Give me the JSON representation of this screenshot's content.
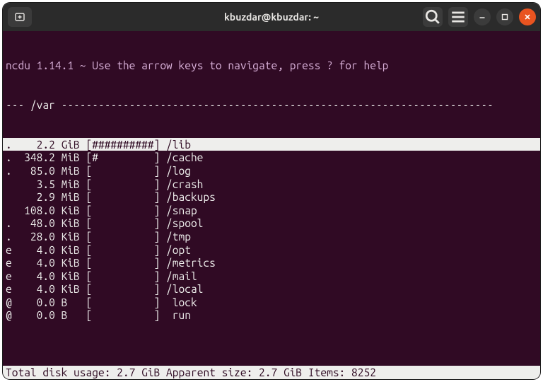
{
  "window": {
    "title": "kbuzdar@kbuzdar: ~"
  },
  "ncdu": {
    "header": "ncdu 1.14.1 ~ Use the arrow keys to navigate, press ? for help",
    "path_line": "--- /var ----------------------------------------------------------------------",
    "footer": " Total disk usage:   2.7 GiB  Apparent size:   2.7 GiB  Items: 8252",
    "rows": [
      {
        "flag": ".",
        "size": "2.2",
        "unit": "GiB",
        "bar": "[##########]",
        "name": "/lib",
        "selected": true
      },
      {
        "flag": ".",
        "size": "348.2",
        "unit": "MiB",
        "bar": "[#         ]",
        "name": "/cache",
        "selected": false
      },
      {
        "flag": ".",
        "size": "85.0",
        "unit": "MiB",
        "bar": "[          ]",
        "name": "/log",
        "selected": false
      },
      {
        "flag": " ",
        "size": "3.5",
        "unit": "MiB",
        "bar": "[          ]",
        "name": "/crash",
        "selected": false
      },
      {
        "flag": " ",
        "size": "2.9",
        "unit": "MiB",
        "bar": "[          ]",
        "name": "/backups",
        "selected": false
      },
      {
        "flag": " ",
        "size": "108.0",
        "unit": "KiB",
        "bar": "[          ]",
        "name": "/snap",
        "selected": false
      },
      {
        "flag": ".",
        "size": "48.0",
        "unit": "KiB",
        "bar": "[          ]",
        "name": "/spool",
        "selected": false
      },
      {
        "flag": ".",
        "size": "28.0",
        "unit": "KiB",
        "bar": "[          ]",
        "name": "/tmp",
        "selected": false
      },
      {
        "flag": "e",
        "size": "4.0",
        "unit": "KiB",
        "bar": "[          ]",
        "name": "/opt",
        "selected": false
      },
      {
        "flag": "e",
        "size": "4.0",
        "unit": "KiB",
        "bar": "[          ]",
        "name": "/metrics",
        "selected": false
      },
      {
        "flag": "e",
        "size": "4.0",
        "unit": "KiB",
        "bar": "[          ]",
        "name": "/mail",
        "selected": false
      },
      {
        "flag": "e",
        "size": "4.0",
        "unit": "KiB",
        "bar": "[          ]",
        "name": "/local",
        "selected": false
      },
      {
        "flag": "@",
        "size": "0.0",
        "unit": "B",
        "bar": "[          ]",
        "name": " lock",
        "selected": false
      },
      {
        "flag": "@",
        "size": "0.0",
        "unit": "B",
        "bar": "[          ]",
        "name": " run",
        "selected": false
      }
    ]
  }
}
